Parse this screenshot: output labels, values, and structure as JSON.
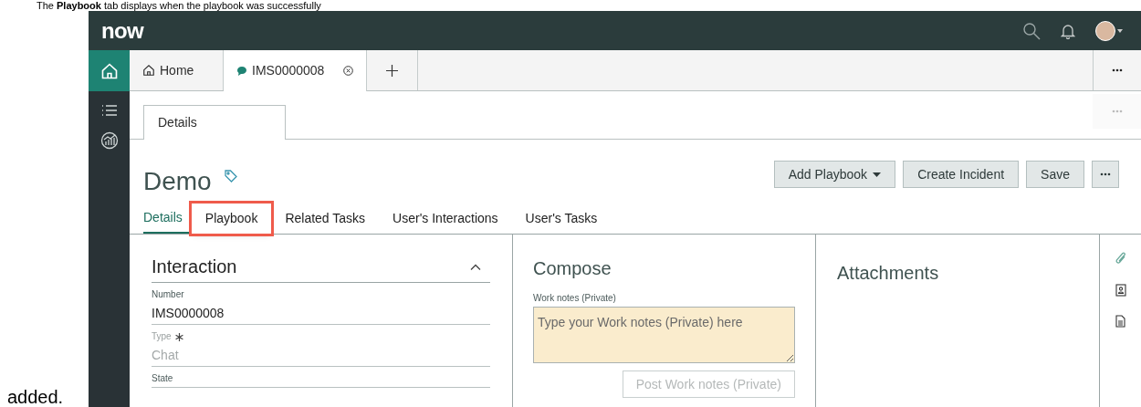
{
  "caption": {
    "before": "The **Playbook** tab displays when the playbook was successfully",
    "after": "added."
  },
  "app": {
    "logo": "now"
  },
  "workspace_tabs": [
    {
      "label": "Home",
      "kind": "home",
      "selected": false
    },
    {
      "label": "IMS0000008",
      "kind": "record",
      "selected": true
    }
  ],
  "sub_tabs": [
    {
      "label": "Details",
      "selected": true
    }
  ],
  "record": {
    "title": "Demo",
    "buttons": [
      {
        "label": "Add Playbook",
        "kind": "dropdown"
      },
      {
        "label": "Create Incident",
        "kind": "plain"
      },
      {
        "label": "Save",
        "kind": "plain"
      }
    ],
    "tabs": [
      {
        "label": "Details",
        "selected": true,
        "highlighted": false
      },
      {
        "label": "Playbook",
        "selected": false,
        "highlighted": true
      },
      {
        "label": "Related Tasks",
        "selected": false,
        "highlighted": false
      },
      {
        "label": "User's Interactions",
        "selected": false,
        "highlighted": false
      },
      {
        "label": "User's Tasks",
        "selected": false,
        "highlighted": false
      }
    ]
  },
  "interaction": {
    "title": "Interaction",
    "expanded": true,
    "fields": [
      {
        "label": "Number",
        "value": "IMS0000008",
        "required": false,
        "disabled": false
      },
      {
        "label": "Type",
        "value": "Chat",
        "required": true,
        "disabled": true
      },
      {
        "label": "State",
        "required": false,
        "disabled": false
      }
    ]
  },
  "compose": {
    "title": "Compose",
    "field_label": "Work notes (Private)",
    "placeholder": "Type your Work notes (Private) here",
    "button": "Post Work notes (Private)",
    "button_disabled": true
  },
  "attachments": {
    "title": "Attachments"
  }
}
